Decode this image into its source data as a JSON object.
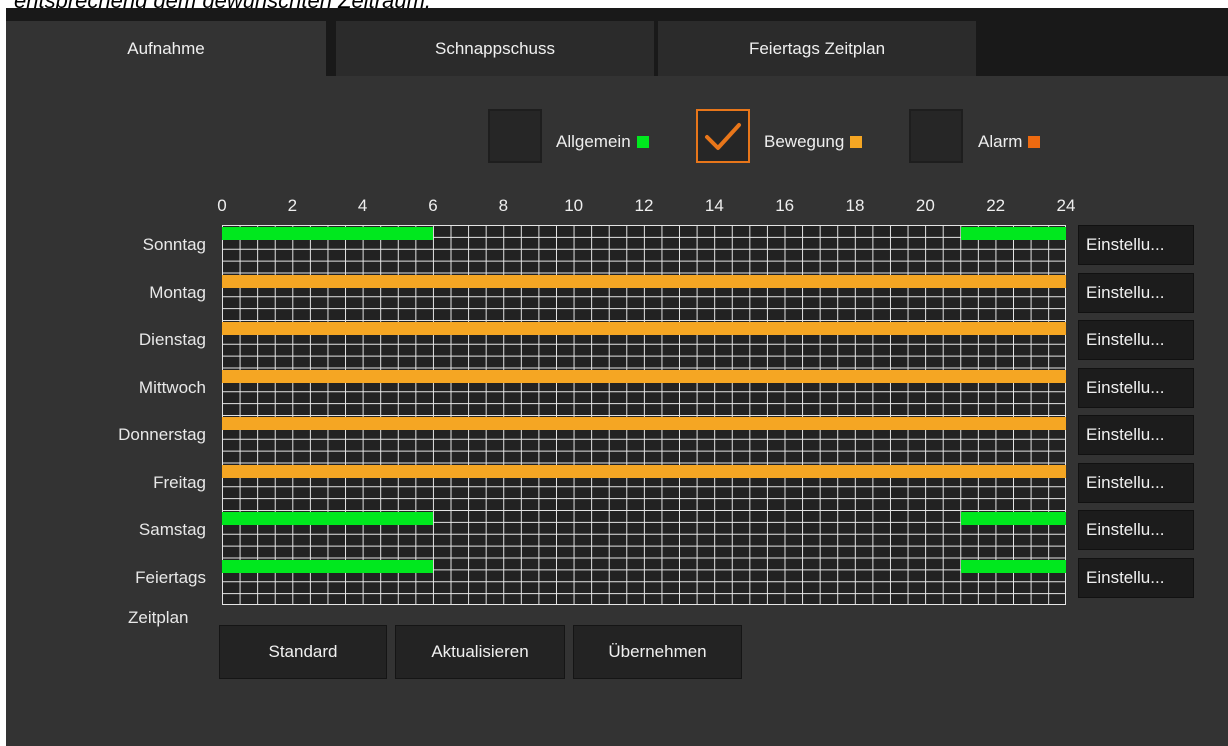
{
  "intro_text": "entsprechend dem gewünschten Zeitraum.",
  "tabs": [
    {
      "label": "Aufnahme",
      "active": true
    },
    {
      "label": "Schnappschuss",
      "active": false
    },
    {
      "label": "Feiertags Zeitplan",
      "active": false
    }
  ],
  "legend": {
    "allgemein": {
      "label": "Allgemein",
      "checked": false,
      "color": "#00e81e"
    },
    "bewegung": {
      "label": "Bewegung",
      "checked": true,
      "color": "#f5a623"
    },
    "alarm": {
      "label": "Alarm",
      "checked": false,
      "color": "#ee6a10"
    }
  },
  "hours": [
    "0",
    "2",
    "4",
    "6",
    "8",
    "10",
    "12",
    "14",
    "16",
    "18",
    "20",
    "22",
    "24"
  ],
  "days": [
    {
      "label": "Sonntag",
      "button": "Einstellu...",
      "schedule": [
        {
          "from": 0,
          "to": 6,
          "type": "allgemein"
        },
        {
          "from": 21,
          "to": 24,
          "type": "allgemein"
        }
      ]
    },
    {
      "label": "Montag",
      "button": "Einstellu...",
      "schedule": [
        {
          "from": 0,
          "to": 24,
          "type": "bewegung"
        }
      ]
    },
    {
      "label": "Dienstag",
      "button": "Einstellu...",
      "schedule": [
        {
          "from": 0,
          "to": 24,
          "type": "bewegung"
        }
      ]
    },
    {
      "label": "Mittwoch",
      "button": "Einstellu...",
      "schedule": [
        {
          "from": 0,
          "to": 24,
          "type": "bewegung"
        }
      ]
    },
    {
      "label": "Donnerstag",
      "button": "Einstellu...",
      "schedule": [
        {
          "from": 0,
          "to": 24,
          "type": "bewegung"
        }
      ]
    },
    {
      "label": "Freitag",
      "button": "Einstellu...",
      "schedule": [
        {
          "from": 0,
          "to": 24,
          "type": "bewegung"
        }
      ]
    },
    {
      "label": "Samstag",
      "button": "Einstellu...",
      "schedule": [
        {
          "from": 0,
          "to": 6,
          "type": "allgemein"
        },
        {
          "from": 21,
          "to": 24,
          "type": "allgemein"
        }
      ]
    },
    {
      "label": "Feiertags",
      "button": "Einstellu...",
      "schedule": [
        {
          "from": 0,
          "to": 6,
          "type": "allgemein"
        },
        {
          "from": 21,
          "to": 24,
          "type": "allgemein"
        }
      ]
    }
  ],
  "zeitplan_label": "Zeitplan",
  "buttons": {
    "standard": "Standard",
    "aktualisieren": "Aktualisieren",
    "uebernehmen": "Übernehmen"
  }
}
